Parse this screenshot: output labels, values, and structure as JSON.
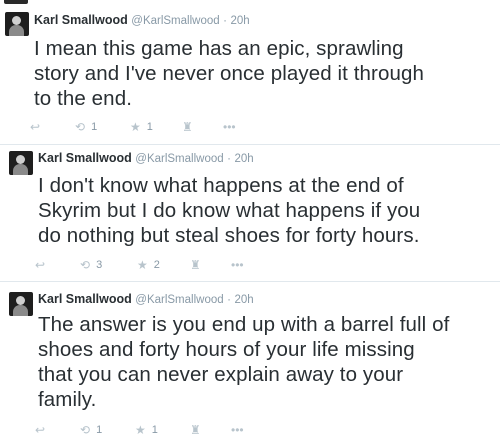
{
  "tweets": [
    {
      "name": "Karl Smallwood",
      "handle": "@KarlSmallwood",
      "separator": "·",
      "time": "20h",
      "text_lines": [
        "I mean this game has an epic, sprawling",
        "story and I've never once played it through",
        "to the end."
      ],
      "retweets": "1",
      "favorites": "1"
    },
    {
      "name": "Karl Smallwood",
      "handle": "@KarlSmallwood",
      "separator": "·",
      "time": "20h",
      "text_lines": [
        "I don't know what happens at the end of",
        "Skyrim but I do know what happens if you",
        "do nothing but steal shoes for forty hours."
      ],
      "retweets": "3",
      "favorites": "2"
    },
    {
      "name": "Karl Smallwood",
      "handle": "@KarlSmallwood",
      "separator": "·",
      "time": "20h",
      "text_lines": [
        "The answer is you end up with a barrel full of",
        "shoes and forty hours of your life missing",
        "that you can never explain away to your",
        "family."
      ],
      "retweets": "1",
      "favorites": "1"
    }
  ],
  "icons": {
    "reply": "reply-icon",
    "retweet": "retweet-icon",
    "favorite": "star-icon",
    "pocket": "pocket-icon",
    "more": "more-icon"
  },
  "icon_glyphs": {
    "reply": "↩",
    "retweet": "⟲",
    "favorite": "★",
    "pocket": "♜",
    "more": "•••"
  }
}
